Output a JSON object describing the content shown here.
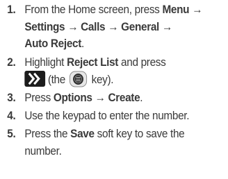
{
  "steps": [
    {
      "number": "1.",
      "line1_prefix": "From the Home screen, press ",
      "menu": "Menu",
      "arrow": "→",
      "line2": [
        "Settings",
        "Calls",
        "General"
      ],
      "line3": "Auto Reject",
      "line3_suffix": "."
    },
    {
      "number": "2.",
      "line1_prefix": "Highlight ",
      "reject_list": "Reject List",
      "line1_suffix": " and press",
      "line2_prefix": "(the ",
      "line2_suffix": " key)."
    },
    {
      "number": "3.",
      "prefix": "Press ",
      "options": "Options",
      "create": "Create",
      "suffix": "."
    },
    {
      "number": "4.",
      "text": "Use the keypad to enter the number."
    },
    {
      "number": "5.",
      "prefix": "Press the ",
      "save": "Save",
      "suffix": " soft key to save the",
      "line2": "number."
    }
  ],
  "icons": {
    "nav_key": "navigation-right-key-icon",
    "ok_key": "ok-key-icon"
  },
  "colors": {
    "text": "#3a3a3a",
    "key_bg": "#1c1c1c"
  }
}
